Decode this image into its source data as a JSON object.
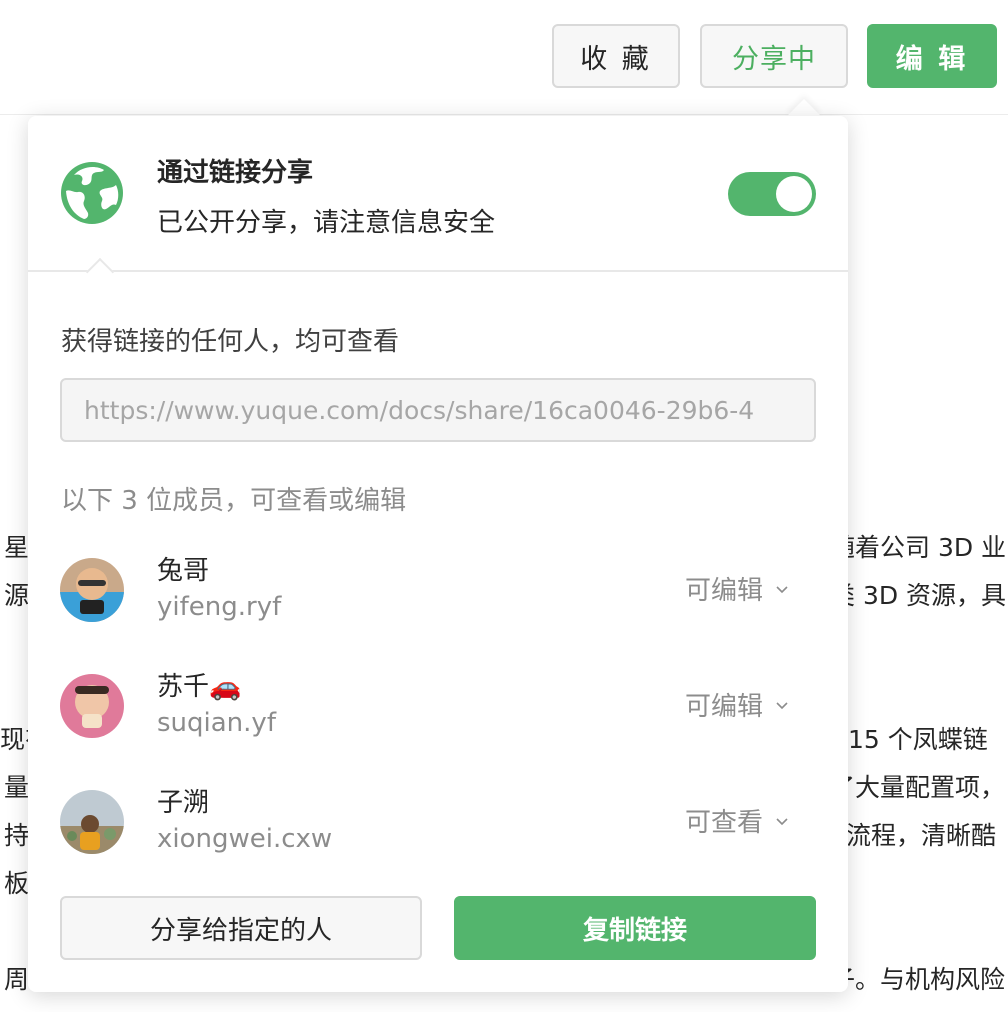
{
  "toolbar": {
    "favorite_label": "收 藏",
    "sharing_label": "分享中",
    "edit_label": "编 辑"
  },
  "background_text": {
    "left": [
      "星",
      "源",
      "现有",
      "量",
      "持",
      "板",
      "周"
    ],
    "right": [
      "随着公司 3D 业",
      "类 3D 资源，具",
      "15 个凤蝶链",
      "了大量配置项，",
      "流程，清晰酷",
      "子。与机构风险"
    ]
  },
  "share_panel": {
    "title": "通过链接分享",
    "description": "已公开分享，请注意信息安全",
    "toggle_on": true,
    "anyone_label": "获得链接的任何人，均可查看",
    "link_url": "https://www.yuque.com/docs/share/16ca0046-29b6-4",
    "members_label": "以下 3 位成员，可查看或编辑",
    "members": [
      {
        "name": "兔哥",
        "id": "yifeng.ryf",
        "permission": "可编辑"
      },
      {
        "name": "苏千🚗",
        "id": "suqian.yf",
        "permission": "可编辑"
      },
      {
        "name": "子溯",
        "id": "xiongwei.cxw",
        "permission": "可查看"
      }
    ],
    "share_to_person_label": "分享给指定的人",
    "copy_link_label": "复制链接"
  },
  "colors": {
    "accent_green": "#53b56d",
    "muted_text": "#8c8c8c",
    "border": "#d9d9d9"
  },
  "icons": {
    "globe": "globe-icon",
    "chevron": "chevron-down-icon"
  }
}
